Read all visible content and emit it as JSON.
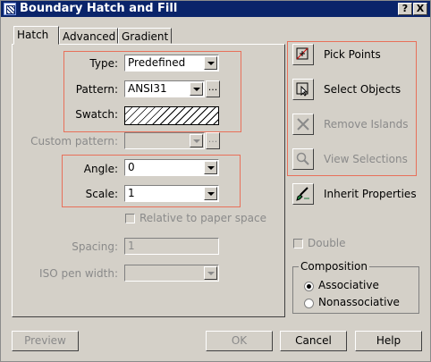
{
  "window": {
    "title": "Boundary Hatch and Fill",
    "help_btn": "?",
    "close_btn": "X"
  },
  "tabs": [
    {
      "label": "Hatch",
      "active": true
    },
    {
      "label": "Advanced",
      "active": false
    },
    {
      "label": "Gradient",
      "active": false
    }
  ],
  "hatch": {
    "type_label": "Type:",
    "type_value": "Predefined",
    "pattern_label": "Pattern:",
    "pattern_value": "ANSI31",
    "pattern_more": "...",
    "swatch_label": "Swatch:",
    "custom_label": "Custom pattern:",
    "custom_value": "",
    "custom_more": "...",
    "angle_label": "Angle:",
    "angle_value": "0",
    "scale_label": "Scale:",
    "scale_value": "1",
    "relative_label": "Relative to paper space",
    "relative_checked": false,
    "spacing_label": "Spacing:",
    "spacing_value": "1",
    "iso_label": "ISO pen width:",
    "iso_value": ""
  },
  "actions": {
    "pick_points": "Pick Points",
    "select_objects": "Select Objects",
    "remove_islands": "Remove Islands",
    "view_selections": "View Selections",
    "inherit_properties": "Inherit Properties"
  },
  "double": {
    "label": "Double",
    "checked": false
  },
  "composition": {
    "title": "Composition",
    "options": [
      {
        "label": "Associative",
        "selected": true
      },
      {
        "label": "Nonassociative",
        "selected": false
      }
    ]
  },
  "buttons": {
    "preview": "Preview",
    "ok": "OK",
    "cancel": "Cancel",
    "help": "Help"
  },
  "colors": {
    "titlebar": "#0a246a",
    "face": "#d4d0c8",
    "highlight_box": "#e8705a",
    "disabled_text": "#8a8a8a"
  }
}
